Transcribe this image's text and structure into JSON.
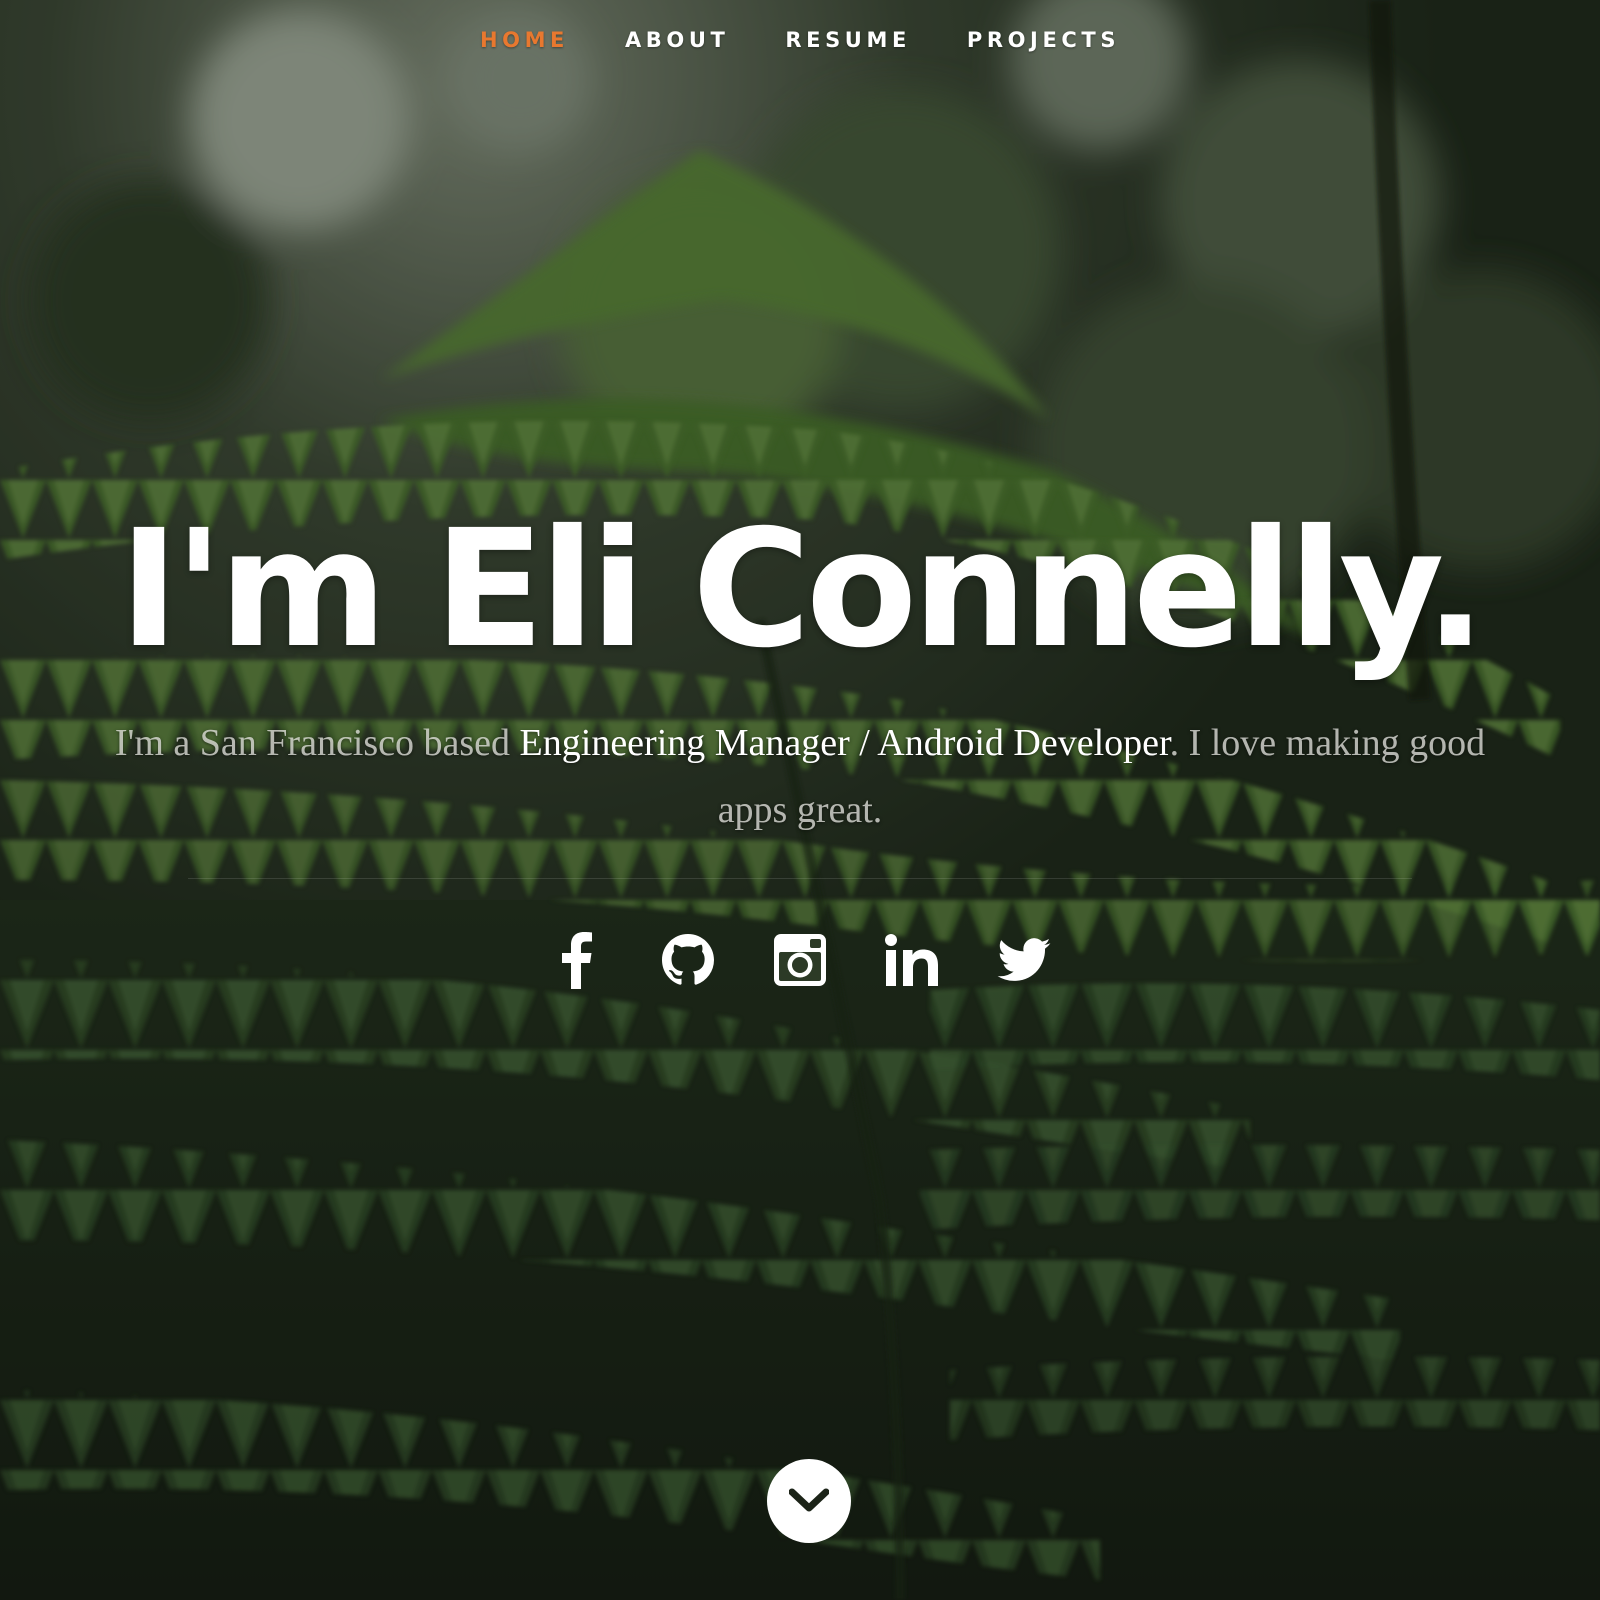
{
  "nav": {
    "items": [
      {
        "label": "HOME",
        "active": true
      },
      {
        "label": "ABOUT",
        "active": false
      },
      {
        "label": "RESUME",
        "active": false
      },
      {
        "label": "PROJECTS",
        "active": false
      }
    ],
    "active_color": "#e8782f"
  },
  "hero": {
    "headline": "I'm Eli Connelly.",
    "intro_before": "I'm a San Francisco based ",
    "intro_highlight": "Engineering Manager / Android Developer",
    "intro_after": ". I love making good apps great."
  },
  "social": {
    "icons": [
      "facebook-icon",
      "github-icon",
      "instagram-icon",
      "linkedin-icon",
      "twitter-icon"
    ]
  },
  "scroll": {
    "icon": "chevron-down-icon"
  },
  "background": {
    "subject": "fern-foliage-photo",
    "tint": "#1a2416"
  }
}
